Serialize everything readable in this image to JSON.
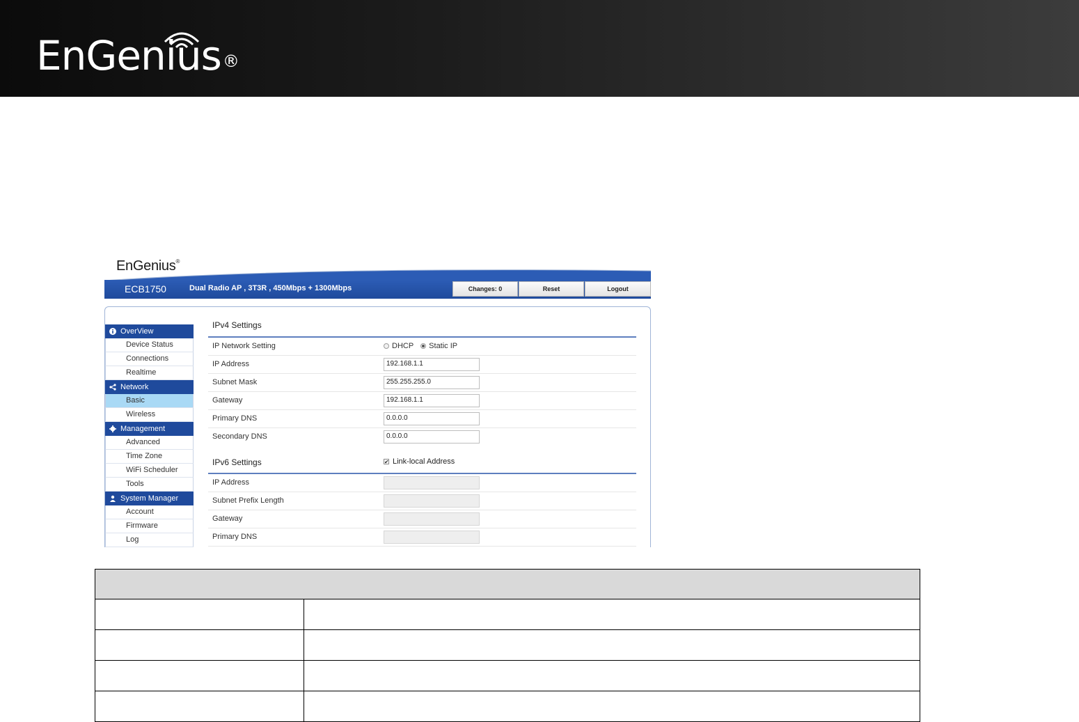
{
  "doc": {
    "logo_text": "EnGenius",
    "logo_reg": "®",
    "table": {
      "rows": [
        {
          "label": "",
          "value": ""
        },
        {
          "label": "",
          "value": ""
        },
        {
          "label": "",
          "value": ""
        },
        {
          "label": "",
          "value": ""
        }
      ]
    }
  },
  "shot": {
    "logo_text": "EnGenius",
    "logo_reg": "®",
    "model": "ECB1750",
    "description": "Dual Radio AP , 3T3R , 450Mbps + 1300Mbps",
    "buttons": {
      "changes": "Changes: 0",
      "reset": "Reset",
      "logout": "Logout"
    },
    "sidebar": {
      "groups": [
        {
          "title": "OverView",
          "icon": "info-icon",
          "items": [
            "Device Status",
            "Connections",
            "Realtime"
          ]
        },
        {
          "title": "Network",
          "icon": "share-icon",
          "items": [
            "Basic",
            "Wireless"
          ]
        },
        {
          "title": "Management",
          "icon": "gear-icon",
          "items": [
            "Advanced",
            "Time Zone",
            "WiFi Scheduler",
            "Tools"
          ]
        },
        {
          "title": "System Manager",
          "icon": "user-icon",
          "items": [
            "Account",
            "Firmware",
            "Log"
          ]
        }
      ],
      "active_item": "Basic"
    },
    "ipv4": {
      "title": "IPv4 Settings",
      "network_setting_label": "IP Network Setting",
      "dhcp_label": "DHCP",
      "static_label": "Static IP",
      "selected": "Static IP",
      "fields": [
        {
          "label": "IP Address",
          "value": "192.168.1.1"
        },
        {
          "label": "Subnet Mask",
          "value": "255.255.255.0"
        },
        {
          "label": "Gateway",
          "value": "192.168.1.1"
        },
        {
          "label": "Primary DNS",
          "value": "0.0.0.0"
        },
        {
          "label": "Secondary DNS",
          "value": "0.0.0.0"
        }
      ]
    },
    "ipv6": {
      "title": "IPv6 Settings",
      "link_local_label": "Link-local Address",
      "link_local_checked": true,
      "fields": [
        {
          "label": "IP Address",
          "value": ""
        },
        {
          "label": "Subnet Prefix Length",
          "value": ""
        },
        {
          "label": "Gateway",
          "value": ""
        },
        {
          "label": "Primary DNS",
          "value": ""
        }
      ]
    },
    "colors": {
      "brand_blue": "#1f4a9c",
      "active_item": "#a9d9f5",
      "rule": "#5e7fbf"
    }
  }
}
